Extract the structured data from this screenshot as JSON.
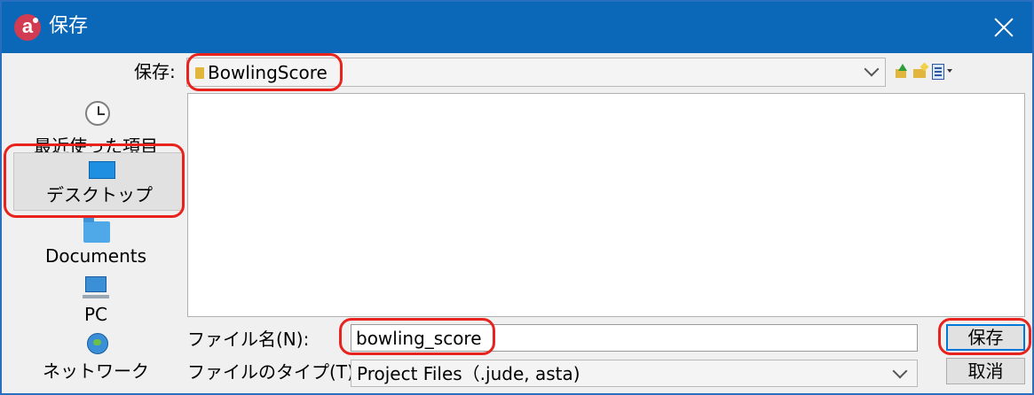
{
  "window": {
    "title": "保存",
    "app_icon_letter": "a",
    "close_icon": "close-icon"
  },
  "look_in": {
    "label": "保存:",
    "value": "BowlingScore",
    "folder_icon": "folder-icon"
  },
  "toolbar": {
    "icons": [
      "up-folder-icon",
      "new-folder-icon",
      "view-menu-icon"
    ]
  },
  "places": {
    "items": [
      {
        "label": "最近使った項目",
        "icon": "clock-icon"
      },
      {
        "label": "デスクトップ",
        "icon": "desktop-icon",
        "selected": true
      },
      {
        "label": "Documents",
        "icon": "folder-icon"
      },
      {
        "label": "PC",
        "icon": "computer-icon"
      },
      {
        "label": "ネットワーク",
        "icon": "network-icon"
      }
    ]
  },
  "file_name": {
    "label": "ファイル名(N):",
    "value": "bowling_score"
  },
  "file_type": {
    "label": "ファイルのタイプ(T):",
    "value": "Project Files（.jude, asta)"
  },
  "buttons": {
    "save_label": "保存",
    "cancel_label": "取消"
  },
  "colors": {
    "titlebar": "#0b68b8",
    "highlight_ring": "#e8231e",
    "default_button_border": "#0078d7"
  }
}
